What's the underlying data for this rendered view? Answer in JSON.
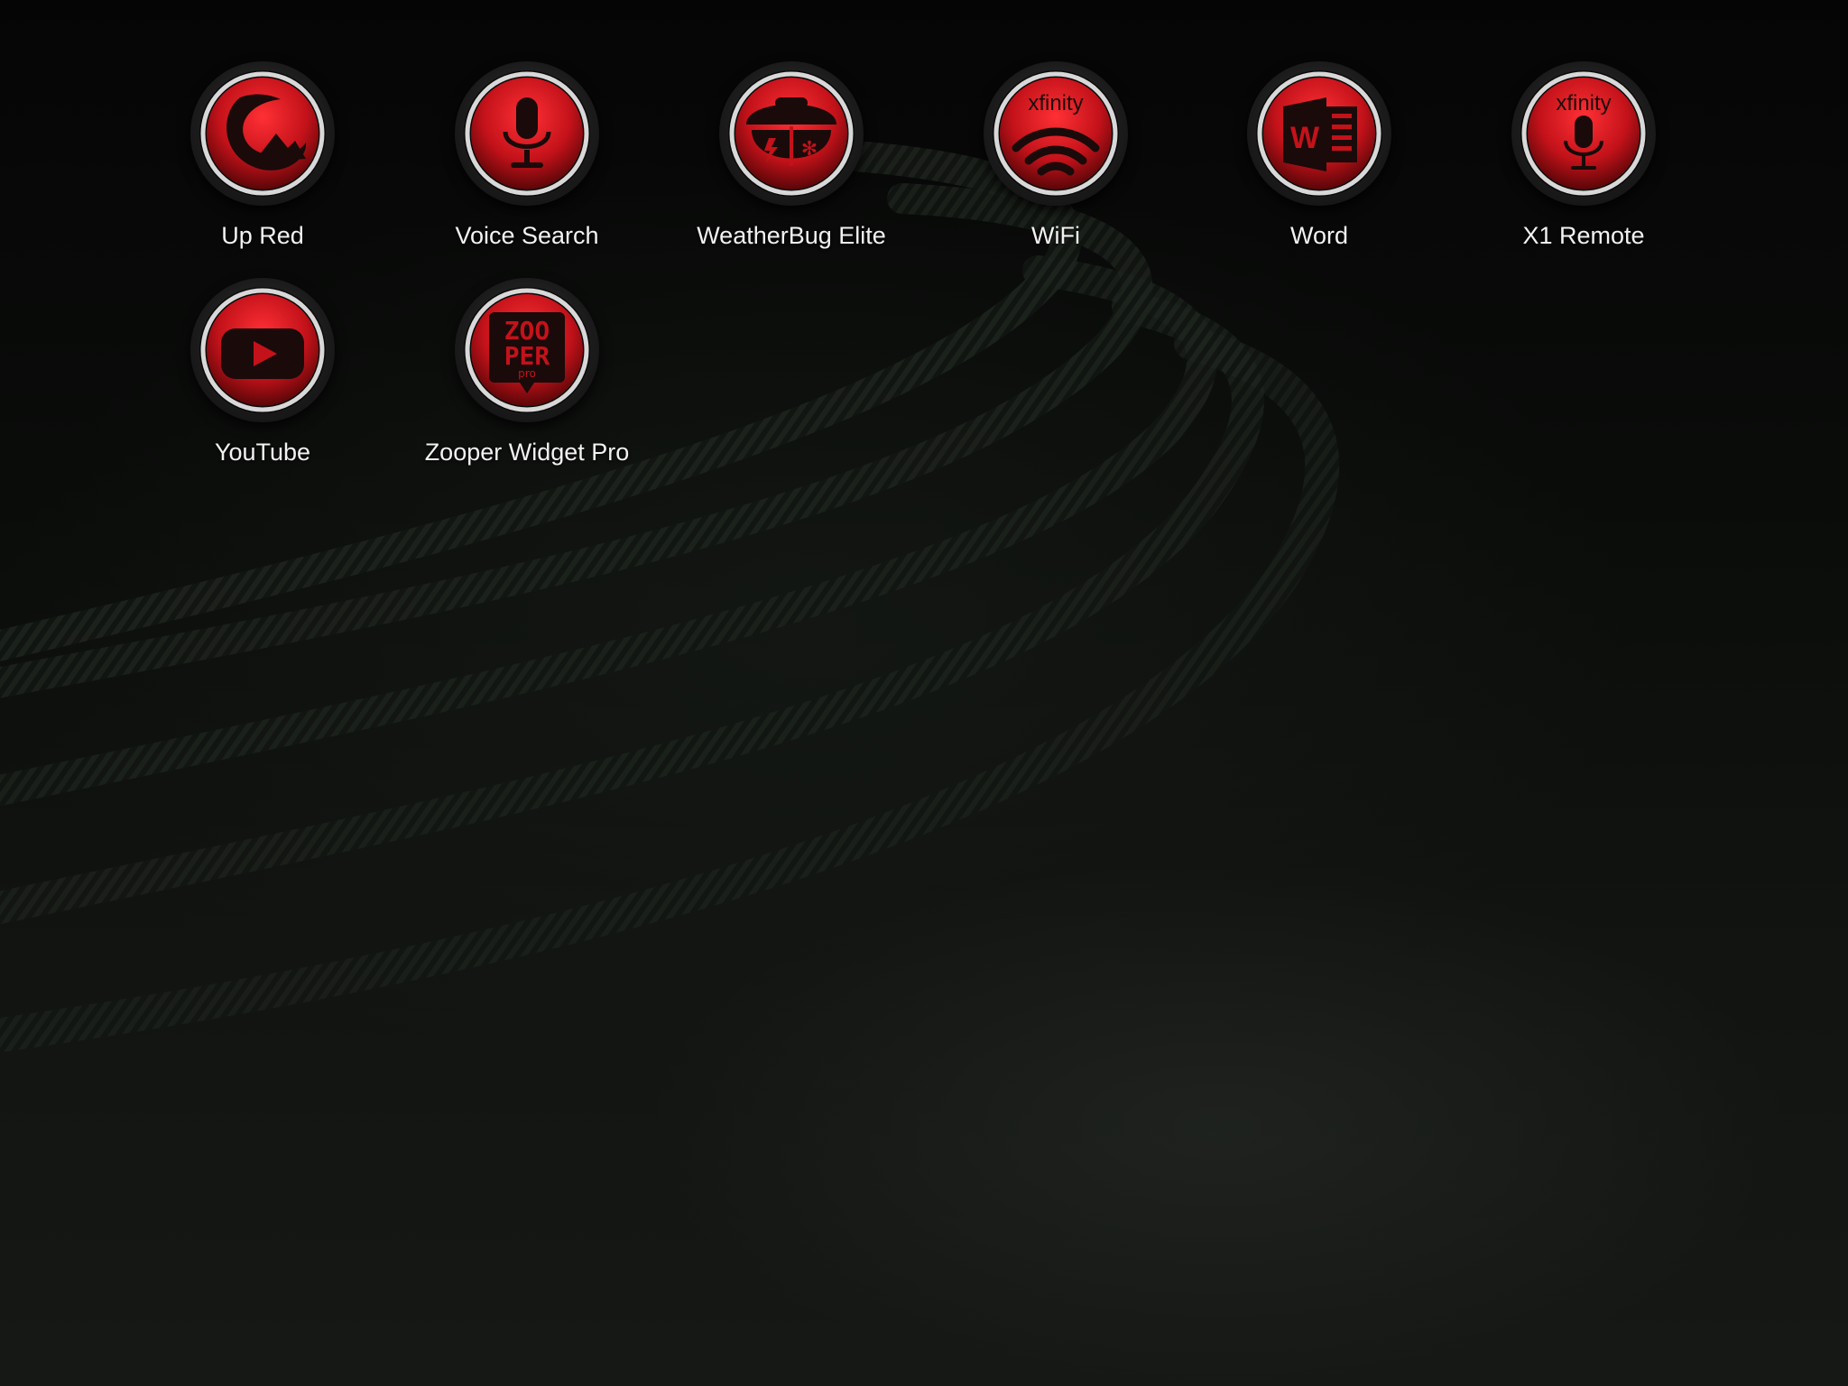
{
  "home_screen": {
    "apps": [
      {
        "label": "Up Red",
        "icon": "swirl-mountain-icon"
      },
      {
        "label": "Voice Search",
        "icon": "microphone-icon"
      },
      {
        "label": "WeatherBug Elite",
        "icon": "weatherbug-icon"
      },
      {
        "label": "WiFi",
        "icon": "wifi-icon",
        "icon_text": "xfinity"
      },
      {
        "label": "Word",
        "icon": "word-document-icon",
        "icon_text": "W"
      },
      {
        "label": "X1 Remote",
        "icon": "microphone-icon",
        "icon_text": "xfinity"
      },
      {
        "label": "YouTube",
        "icon": "play-button-icon"
      },
      {
        "label": "Zooper Widget Pro",
        "icon": "zooper-icon",
        "icon_text": "ZOO PER pro"
      }
    ],
    "colors": {
      "icon_red": "#d4181c",
      "icon_dark_red": "#5a0608",
      "ring_silver": "#d8d8d8",
      "label_text": "#f2f2f2"
    }
  }
}
